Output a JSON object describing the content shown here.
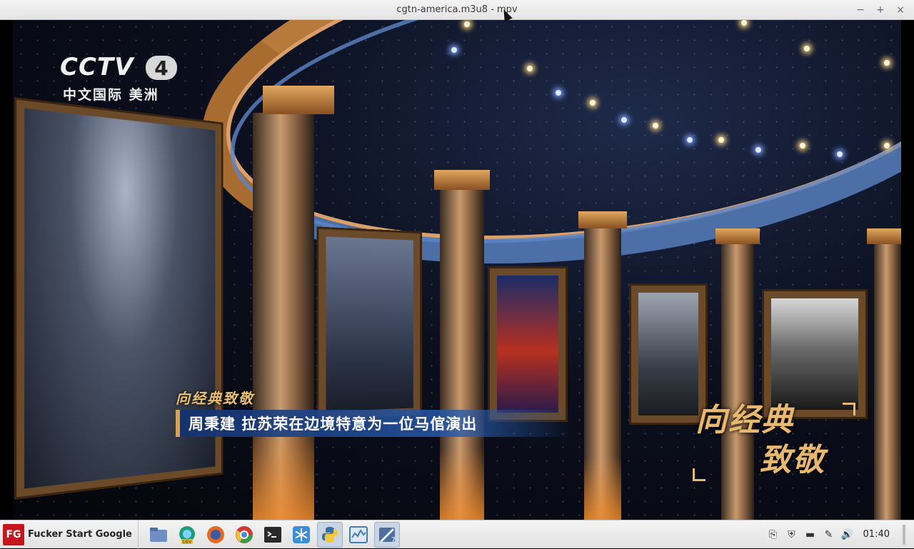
{
  "window": {
    "title": "cgtn-america.m3u8 - mpv",
    "minimize_glyph": "−",
    "maximize_glyph": "+",
    "close_glyph": "×"
  },
  "video": {
    "channel_logo": "CCTV",
    "channel_number": "4",
    "channel_subtitle": "中文国际 美洲",
    "caption_small": "向经典致敬",
    "caption_main": "周秉建  拉苏荣在边境特意为一位马倌演出",
    "emblem_line1": "向经典",
    "emblem_line2": "致敬"
  },
  "taskbar": {
    "start_logo": "FG",
    "start_label": "Fucker Start Google",
    "launchers": [
      {
        "name": "file-manager-icon",
        "color": "#5a7fb8"
      },
      {
        "name": "edge-dev-icon",
        "color": "#1a8e6a"
      },
      {
        "name": "firefox-icon",
        "color": "#e66a1f"
      },
      {
        "name": "chrome-icon",
        "color": "#d33a2f"
      },
      {
        "name": "terminal-icon",
        "color": "#2a2a2a"
      },
      {
        "name": "snowflake-app-icon",
        "color": "#3a8fd8"
      },
      {
        "name": "python-icon",
        "color": "#3770a0"
      },
      {
        "name": "system-monitor-icon",
        "color": "#3f7fbf"
      },
      {
        "name": "mpv-icon",
        "color": "#4f6fa0"
      }
    ],
    "clock": "01:40",
    "tray": {
      "clipboard": "⎘",
      "shield": "⛨",
      "keyboard": "▬",
      "pen": "✎",
      "volume": "🔊"
    }
  }
}
